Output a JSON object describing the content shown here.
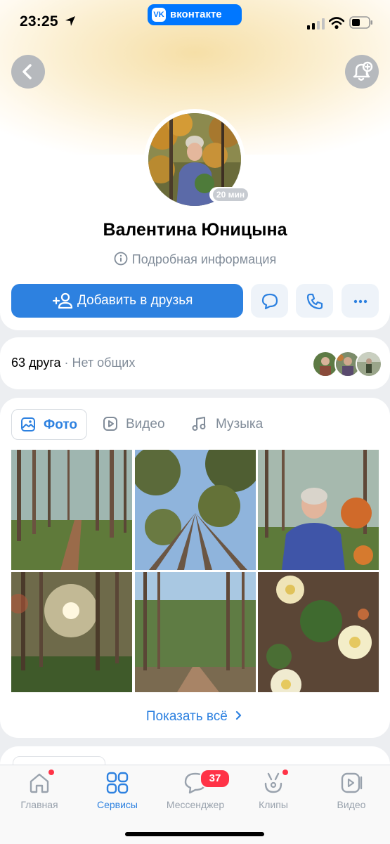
{
  "status_bar": {
    "time": "23:25",
    "app_badge": "вконтакте",
    "app_badge_logo": "VK"
  },
  "profile": {
    "name": "Валентина Юницына",
    "last_seen": "20 мин",
    "info_link": "Подробная информация",
    "add_friend_label": "Добавить в друзья"
  },
  "friends": {
    "count": "63 друга",
    "separator": " · ",
    "common": "Нет общих"
  },
  "media": {
    "tabs": [
      {
        "label": "Фото"
      },
      {
        "label": "Видео"
      },
      {
        "label": "Музыка"
      }
    ],
    "show_all": "Показать всё"
  },
  "tabbar": {
    "items": [
      {
        "label": "Главная"
      },
      {
        "label": "Сервисы"
      },
      {
        "label": "Мессенджер"
      },
      {
        "label": "Клипы"
      },
      {
        "label": "Видео"
      }
    ],
    "messenger_badge": "37"
  },
  "colors": {
    "accent": "#2d81e0",
    "brand": "#0077ff",
    "badge": "#ff3347",
    "secondary_text": "#818c99"
  }
}
